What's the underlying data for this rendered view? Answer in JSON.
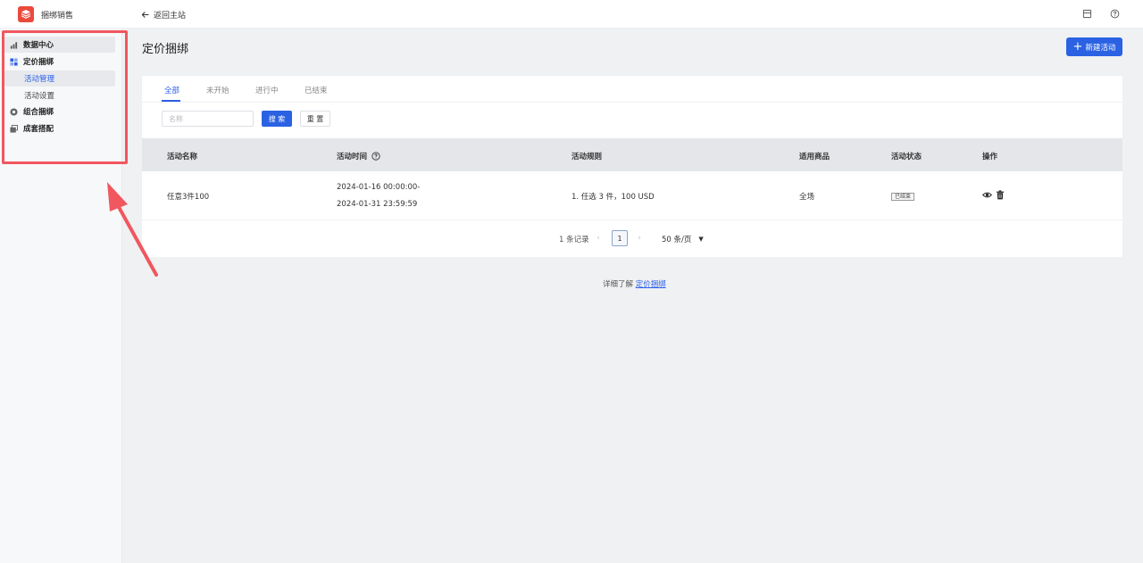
{
  "app": {
    "name": "捆绑销售",
    "back_label": "返回主站"
  },
  "sidebar": {
    "items": [
      {
        "label": "数据中心",
        "icon": "bar-chart-icon"
      },
      {
        "label": "定价捆绑",
        "icon": "grid-icon"
      },
      {
        "label": "活动管理"
      },
      {
        "label": "活动设置"
      },
      {
        "label": "组合捆绑",
        "icon": "circle-dot-icon"
      },
      {
        "label": "成套搭配",
        "icon": "stack-icon"
      }
    ]
  },
  "page": {
    "title": "定价捆绑",
    "new_button": "新建活动"
  },
  "tabs": [
    "全部",
    "未开始",
    "进行中",
    "已结束"
  ],
  "filter": {
    "name_placeholder": "名称",
    "search_label": "搜 索",
    "reset_label": "重 置"
  },
  "table": {
    "headers": [
      "活动名称",
      "活动时间",
      "活动规则",
      "适用商品",
      "活动状态",
      "操作"
    ],
    "rows": [
      {
        "name": "任意3件100",
        "time_start": "2024-01-16 00:00:00-",
        "time_end": "2024-01-31 23:59:59",
        "rule": "1. 任选 3 件，100 USD",
        "products": "全场",
        "status": "已结束"
      }
    ]
  },
  "pagination": {
    "total": "1 条记录",
    "current": "1",
    "page_size": "50 条/页"
  },
  "footer": {
    "text": "详细了解",
    "link": "定价捆绑"
  },
  "colors": {
    "accent": "#2b62e3",
    "brand": "#e94a3b",
    "highlight": "#f0575f"
  }
}
